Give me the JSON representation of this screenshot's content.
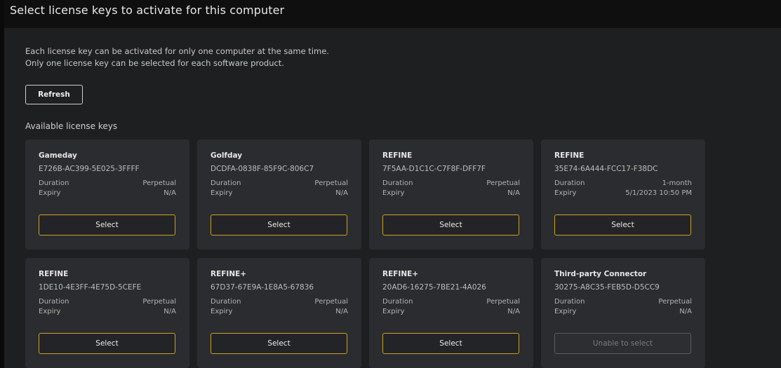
{
  "header": {
    "title": "Select license keys to activate for this computer"
  },
  "info": {
    "line1": "Each license key can be activated for only one computer at the same time.",
    "line2": "Only one license key can be selected for each software product."
  },
  "refresh_label": "Refresh",
  "section_label": "Available license keys",
  "labels": {
    "duration": "Duration",
    "expiry": "Expiry"
  },
  "colors": {
    "accent": "#c9a227",
    "card_bg": "#2b2c2f",
    "page_bg": "#1e1f21",
    "header_bg": "#0f0f10"
  },
  "licenses": [
    {
      "name": "Gameday",
      "key": "E726B-AC399-5E025-3FFFF",
      "duration": "Perpetual",
      "expiry": "N/A",
      "button": "Select",
      "disabled": false
    },
    {
      "name": "Golfday",
      "key": "DCDFA-0838F-85F9C-806C7",
      "duration": "Perpetual",
      "expiry": "N/A",
      "button": "Select",
      "disabled": false
    },
    {
      "name": "REFINE",
      "key": "7F5AA-D1C1C-C7F8F-DFF7F",
      "duration": "Perpetual",
      "expiry": "N/A",
      "button": "Select",
      "disabled": false
    },
    {
      "name": "REFINE",
      "key": "35E74-6A444-FCC17-F38DC",
      "duration": "1-month",
      "expiry": "5/1/2023 10:50 PM",
      "button": "Select",
      "disabled": false
    },
    {
      "name": "REFINE",
      "key": "1DE10-4E3FF-4E75D-5CEFE",
      "duration": "Perpetual",
      "expiry": "N/A",
      "button": "Select",
      "disabled": false
    },
    {
      "name": "REFINE+",
      "key": "67D37-67E9A-1E8A5-67836",
      "duration": "Perpetual",
      "expiry": "N/A",
      "button": "Select",
      "disabled": false
    },
    {
      "name": "REFINE+",
      "key": "20AD6-16275-7BE21-4A026",
      "duration": "Perpetual",
      "expiry": "N/A",
      "button": "Select",
      "disabled": false
    },
    {
      "name": "Third-party Connector",
      "key": "30275-A8C35-FEB5D-D5CC9",
      "duration": "Perpetual",
      "expiry": "N/A",
      "button": "Unable to select",
      "disabled": true
    }
  ]
}
